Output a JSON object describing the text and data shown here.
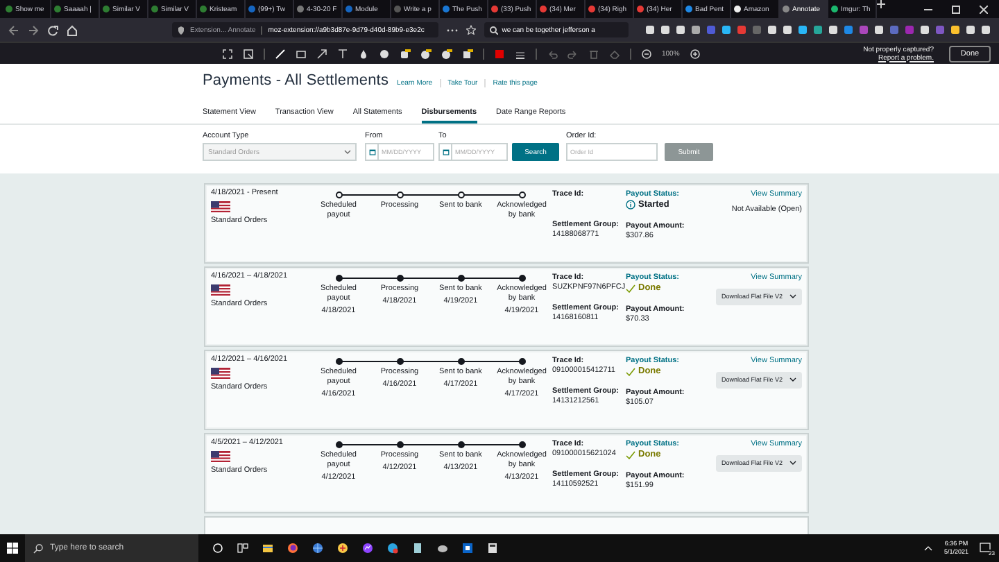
{
  "browser": {
    "tabs": [
      {
        "label": "Show me",
        "selected": false
      },
      {
        "label": "Saaaah |",
        "selected": false
      },
      {
        "label": "Similar V",
        "selected": false
      },
      {
        "label": "Similar V",
        "selected": false
      },
      {
        "label": "Kristeam",
        "selected": false
      },
      {
        "label": "(99+) Tw",
        "selected": false
      },
      {
        "label": "4-30-20 F",
        "selected": false
      },
      {
        "label": "Module",
        "selected": false
      },
      {
        "label": "Write a p",
        "selected": false
      },
      {
        "label": "The Push",
        "selected": false
      },
      {
        "label": "(33) Push",
        "selected": false
      },
      {
        "label": "(34) Mer",
        "selected": false
      },
      {
        "label": "(34) Righ",
        "selected": false
      },
      {
        "label": "(34) Her",
        "selected": false
      },
      {
        "label": "Bad Pent",
        "selected": false
      },
      {
        "label": "Amazon",
        "selected": false
      },
      {
        "label": "Annotate",
        "selected": true
      },
      {
        "label": "Imgur: Th",
        "selected": false
      }
    ],
    "site_label": "Extension... Annotate",
    "url": "moz-extension://a9b3d87e-9d79-d40d-89b9-e3e2c",
    "search": "we can be together jefferson a"
  },
  "annotation_toolbar": {
    "zoom": "100%",
    "capture_note": "Not properly captured?",
    "report_link": "Report a problem.",
    "done_button": "Done"
  },
  "page": {
    "title": "Payments - All Settlements",
    "header_links": [
      "Learn More",
      "Take Tour",
      "Rate this page"
    ],
    "tabs": [
      {
        "label": "Statement View",
        "selected": false
      },
      {
        "label": "Transaction View",
        "selected": false
      },
      {
        "label": "All Statements",
        "selected": false
      },
      {
        "label": "Disbursements",
        "selected": true
      },
      {
        "label": "Date Range Reports",
        "selected": false
      }
    ],
    "filters": {
      "account_type": {
        "label": "Account Type",
        "value": "Standard Orders"
      },
      "from": {
        "label": "From",
        "placeholder": "MM/DD/YYYY"
      },
      "to": {
        "label": "To",
        "placeholder": "MM/DD/YYYY"
      },
      "search_button": "Search",
      "order_id": {
        "label": "Order Id:",
        "placeholder": "Order Id"
      },
      "submit_button": "Submit"
    }
  },
  "settlements": [
    {
      "period": "4/18/2021 - Present",
      "account": "Standard Orders",
      "steps": [
        {
          "label": "Scheduled payout",
          "completed": false
        },
        {
          "label": "Processing",
          "completed": false
        },
        {
          "label": "Sent to bank",
          "completed": false
        },
        {
          "label": "Acknowledged by bank",
          "completed": false
        }
      ],
      "trace_id_label": "Trace Id:",
      "settlement_group_label": "Settlement Group:",
      "settlement_group": "14188068771",
      "payout_status_label": "Payout Status:",
      "payout_status": {
        "kind": "started",
        "text": "Started"
      },
      "payout_amount_label": "Payout Amount:",
      "payout_amount": "$307.86",
      "view_summary": "View Summary",
      "action": {
        "kind": "note",
        "text": "Not Available (Open)"
      }
    },
    {
      "period": "4/16/2021 – 4/18/2021",
      "account": "Standard Orders",
      "steps": [
        {
          "label": "Scheduled payout",
          "date": "4/18/2021",
          "completed": true
        },
        {
          "label": "Processing",
          "date": "4/18/2021",
          "completed": true
        },
        {
          "label": "Sent to bank",
          "date": "4/19/2021",
          "completed": true
        },
        {
          "label": "Acknowledged by bank",
          "date": "4/19/2021",
          "completed": true
        }
      ],
      "trace_id_label": "Trace Id:",
      "trace_id": "SUZKPNF97N6PFCJ",
      "settlement_group_label": "Settlement Group:",
      "settlement_group": "14168160811",
      "payout_status_label": "Payout Status:",
      "payout_status": {
        "kind": "done",
        "text": "Done"
      },
      "payout_amount_label": "Payout Amount:",
      "payout_amount": "$70.33",
      "view_summary": "View Summary",
      "action": {
        "kind": "download",
        "text": "Download Flat File V2"
      }
    },
    {
      "period": "4/12/2021 – 4/16/2021",
      "account": "Standard Orders",
      "steps": [
        {
          "label": "Scheduled payout",
          "date": "4/16/2021",
          "completed": true
        },
        {
          "label": "Processing",
          "date": "4/16/2021",
          "completed": true
        },
        {
          "label": "Sent to bank",
          "date": "4/17/2021",
          "completed": true
        },
        {
          "label": "Acknowledged by bank",
          "date": "4/17/2021",
          "completed": true
        }
      ],
      "trace_id_label": "Trace Id:",
      "trace_id": "091000015412711",
      "settlement_group_label": "Settlement Group:",
      "settlement_group": "14131212561",
      "payout_status_label": "Payout Status:",
      "payout_status": {
        "kind": "done",
        "text": "Done"
      },
      "payout_amount_label": "Payout Amount:",
      "payout_amount": "$105.07",
      "view_summary": "View Summary",
      "action": {
        "kind": "download",
        "text": "Download Flat File V2"
      }
    },
    {
      "period": "4/5/2021 – 4/12/2021",
      "account": "Standard Orders",
      "steps": [
        {
          "label": "Scheduled payout",
          "date": "4/12/2021",
          "completed": true
        },
        {
          "label": "Processing",
          "date": "4/12/2021",
          "completed": true
        },
        {
          "label": "Sent to bank",
          "date": "4/13/2021",
          "completed": true
        },
        {
          "label": "Acknowledged by bank",
          "date": "4/13/2021",
          "completed": true
        }
      ],
      "trace_id_label": "Trace Id:",
      "trace_id": "091000015621024",
      "settlement_group_label": "Settlement Group:",
      "settlement_group": "14110592521",
      "payout_status_label": "Payout Status:",
      "payout_status": {
        "kind": "done",
        "text": "Done"
      },
      "payout_amount_label": "Payout Amount:",
      "payout_amount": "$151.99",
      "view_summary": "View Summary",
      "action": {
        "kind": "download",
        "text": "Download Flat File V2"
      }
    }
  ],
  "taskbar": {
    "search_placeholder": "Type here to search",
    "time": "6:36 PM",
    "date": "5/1/2021",
    "notification_count": "23"
  }
}
